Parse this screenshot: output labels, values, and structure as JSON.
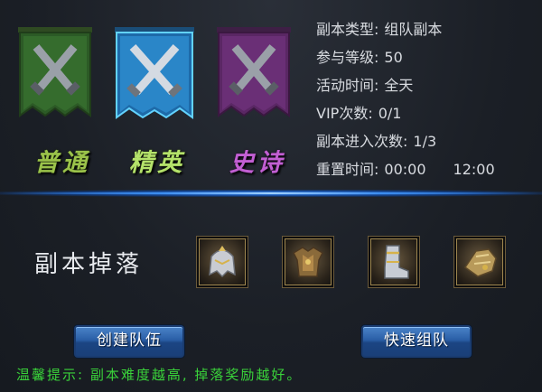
{
  "modes": {
    "normal_label": "普通",
    "elite_label": "精英",
    "epic_label": "史诗",
    "selected": "精英"
  },
  "info": {
    "type_key": "副本类型:",
    "type_val": "组队副本",
    "level_key": "参与等级:",
    "level_val": "50",
    "time_key": "活动时间:",
    "time_val": "全天",
    "vip_key": "VIP次数:",
    "vip_val": "0/1",
    "entry_key": "副本进入次数:",
    "entry_val": "1/3",
    "reset_key": "重置时间:",
    "reset_val1": "00:00",
    "reset_val2": "12:00"
  },
  "drops": {
    "title": "副本掉落",
    "items": [
      "helmet-icon",
      "armor-icon",
      "boots-icon",
      "gauntlet-icon"
    ]
  },
  "buttons": {
    "create_team": "创建队伍",
    "quick_team": "快速组队"
  },
  "tip": "温馨提示: 副本难度越高, 掉落奖励越好。",
  "colors": {
    "normal": "#9ac24a",
    "elite": "#b4e26a",
    "epic": "#c25fd3",
    "tip": "#3ad33a"
  }
}
